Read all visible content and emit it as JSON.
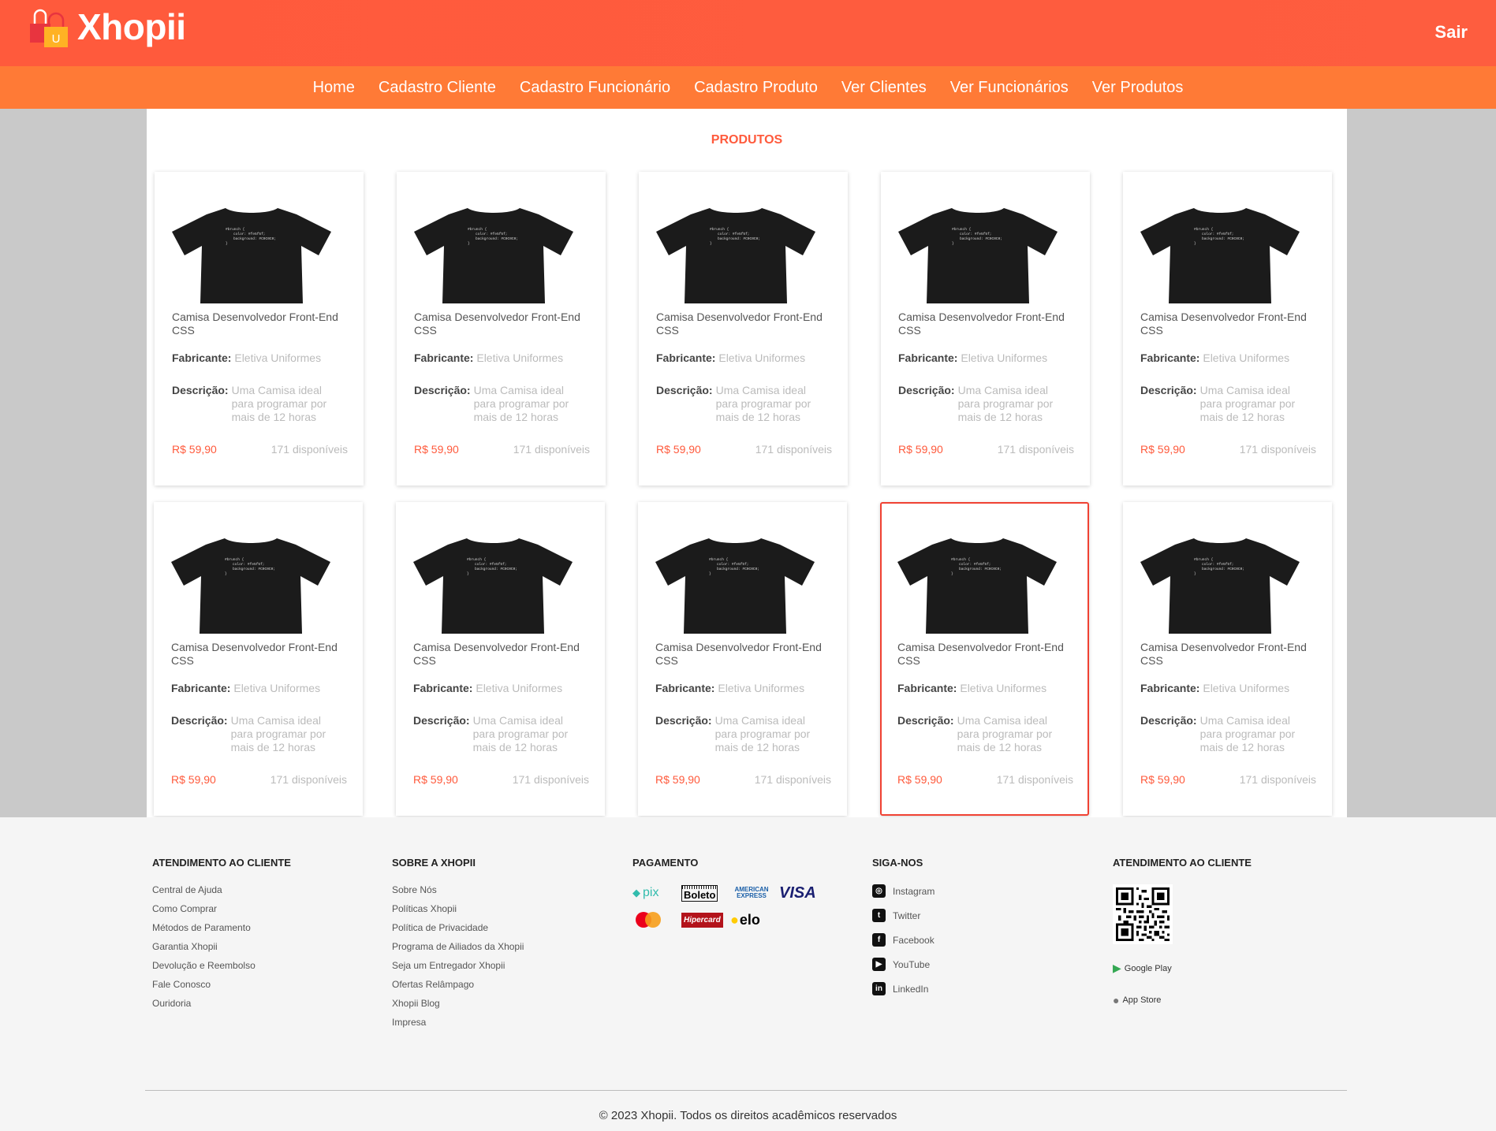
{
  "header": {
    "brand": "Xhopii",
    "logo_letter": "U",
    "logout_label": "Sair",
    "accent_color": "#ff5a3c"
  },
  "nav": {
    "items": [
      "Home",
      "Cadastro Cliente",
      "Cadastro Funcionário",
      "Cadastro Produto",
      "Ver Clientes",
      "Ver Funcionários",
      "Ver Produtos"
    ]
  },
  "main": {
    "title": "PRODUTOS"
  },
  "product_labels": {
    "manufacturer": "Fabricante:",
    "description": "Descrição:"
  },
  "shirt_code": [
    "#brunch {",
    "color: #fe5f5f;",
    "background: #C0C0C0;",
    "}"
  ],
  "products": [
    {
      "name": "Camisa Desenvolvedor Front-End CSS",
      "manufacturer": "Eletiva Uniformes",
      "description": "Uma Camisa ideal para programar por mais de 12 horas",
      "price": "R$ 59,90",
      "stock": "171 disponíveis"
    },
    {
      "name": "Camisa Desenvolvedor Front-End CSS",
      "manufacturer": "Eletiva Uniformes",
      "description": "Uma Camisa ideal para programar por mais de 12 horas",
      "price": "R$ 59,90",
      "stock": "171 disponíveis"
    },
    {
      "name": "Camisa Desenvolvedor Front-End CSS",
      "manufacturer": "Eletiva Uniformes",
      "description": "Uma Camisa ideal para programar por mais de 12 horas",
      "price": "R$ 59,90",
      "stock": "171 disponíveis"
    },
    {
      "name": "Camisa Desenvolvedor Front-End CSS",
      "manufacturer": "Eletiva Uniformes",
      "description": "Uma Camisa ideal para programar por mais de 12 horas",
      "price": "R$ 59,90",
      "stock": "171 disponíveis"
    },
    {
      "name": "Camisa Desenvolvedor Front-End CSS",
      "manufacturer": "Eletiva Uniformes",
      "description": "Uma Camisa ideal para programar por mais de 12 horas",
      "price": "R$ 59,90",
      "stock": "171 disponíveis"
    },
    {
      "name": "Camisa Desenvolvedor Front-End CSS",
      "manufacturer": "Eletiva Uniformes",
      "description": "Uma Camisa ideal para programar por mais de 12 horas",
      "price": "R$ 59,90",
      "stock": "171 disponíveis"
    },
    {
      "name": "Camisa Desenvolvedor Front-End CSS",
      "manufacturer": "Eletiva Uniformes",
      "description": "Uma Camisa ideal para programar por mais de 12 horas",
      "price": "R$ 59,90",
      "stock": "171 disponíveis"
    },
    {
      "name": "Camisa Desenvolvedor Front-End CSS",
      "manufacturer": "Eletiva Uniformes",
      "description": "Uma Camisa ideal para programar por mais de 12 horas",
      "price": "R$ 59,90",
      "stock": "171 disponíveis"
    },
    {
      "name": "Camisa Desenvolvedor Front-End CSS",
      "manufacturer": "Eletiva Uniformes",
      "description": "Uma Camisa ideal para programar por mais de 12 horas",
      "price": "R$ 59,90",
      "stock": "171 disponíveis",
      "selected": true
    },
    {
      "name": "Camisa Desenvolvedor Front-End CSS",
      "manufacturer": "Eletiva Uniformes",
      "description": "Uma Camisa ideal para programar por mais de 12 horas",
      "price": "R$ 59,90",
      "stock": "171 disponíveis"
    }
  ],
  "footer": {
    "col1": {
      "title": "ATENDIMENTO AO CLIENTE",
      "links": [
        "Central de Ajuda",
        "Como Comprar",
        "Métodos de Paramento",
        "Garantia Xhopii",
        "Devolução e Reembolso",
        "Fale Conosco",
        "Ouridoria"
      ]
    },
    "col2": {
      "title": "SOBRE A XHOPII",
      "links": [
        "Sobre Nós",
        "Políticas Xhopii",
        "Política de Privacidade",
        "Programa de Ailiados da Xhopii",
        "Seja um Entregador Xhopii",
        "Ofertas Relâmpago",
        "Xhopii Blog",
        "Impresa"
      ]
    },
    "col3": {
      "title": "PAGAMENTO",
      "methods": [
        "pix",
        "Boleto",
        "AMERICAN EXPRESS",
        "VISA",
        "mastercard-icon",
        "Hipercard",
        "elo"
      ]
    },
    "col4": {
      "title": "SIGA-NOS",
      "social": [
        {
          "label": "Instagram",
          "icon": "instagram-icon"
        },
        {
          "label": "Twitter",
          "icon": "twitter-icon"
        },
        {
          "label": "Facebook",
          "icon": "facebook-icon"
        },
        {
          "label": "YouTube",
          "icon": "youtube-icon"
        },
        {
          "label": "LinkedIn",
          "icon": "linkedin-icon"
        }
      ]
    },
    "col5": {
      "title": "ATENDIMENTO AO CLIENTE",
      "google_play": "Google Play",
      "app_store": "App Store"
    },
    "copyright": "© 2023 Xhopii. Todos os direitos acadêmicos reservados"
  }
}
